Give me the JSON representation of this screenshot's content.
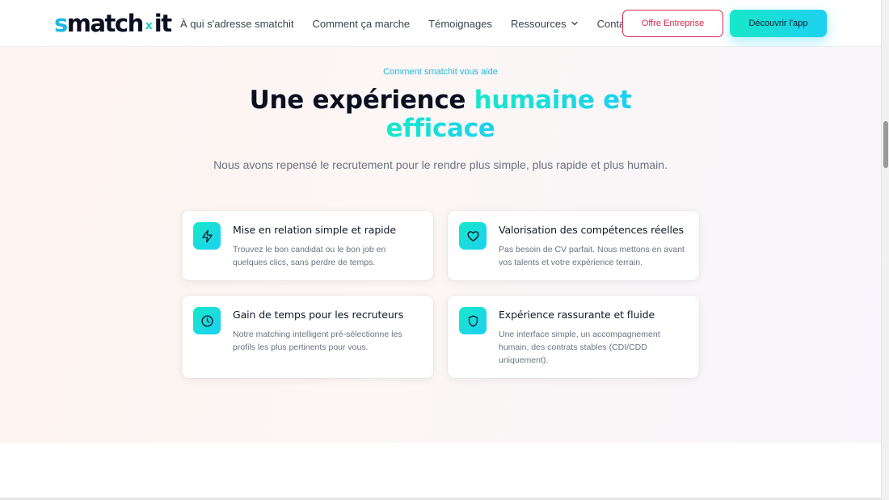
{
  "header": {
    "logo": {
      "part1": "s",
      "part2": "match",
      "sep": "x",
      "part3": "it"
    },
    "nav": [
      {
        "label": "À qui s'adresse smatchit"
      },
      {
        "label": "Comment ça marche"
      },
      {
        "label": "Témoignages"
      },
      {
        "label": "Ressources",
        "icon": "chevron-down-icon"
      },
      {
        "label": "Contact"
      }
    ],
    "cta_outline": "Offre Entreprise",
    "cta_primary": "Découvrir l'app"
  },
  "section": {
    "eyebrow": "Comment smatchit vous aide",
    "title_plain": "Une expérience",
    "title_accent_1": "humaine et",
    "title_accent_2": "efficace",
    "subtitle": "Nous avons repensé le recrutement pour le rendre plus simple, plus rapide et plus humain.",
    "cards": [
      {
        "icon": "lightning-icon",
        "title": "Mise en relation simple et rapide",
        "text": "Trouvez le bon candidat ou le bon job en quelques clics, sans perdre de temps."
      },
      {
        "icon": "heart-icon",
        "title": "Valorisation des compétences réelles",
        "text": "Pas besoin de CV parfait. Nous mettons en avant vos talents et votre expérience terrain."
      },
      {
        "icon": "clock-icon",
        "title": "Gain de temps pour les recruteurs",
        "text": "Notre matching intelligent pré-sélectionne les profils les plus pertinents pour vous."
      },
      {
        "icon": "shield-icon",
        "title": "Expérience rassurante et fluide",
        "text": "Une interface simple, un accompagnement humain, des contrats stables (CDI/CDD uniquement)."
      }
    ]
  },
  "colors": {
    "accent_cyan": "#1cd0f0",
    "accent_teal": "#17e8c9",
    "cta_red": "#d6294c",
    "text_dark": "#0b1020",
    "text_muted": "#6b7280"
  }
}
